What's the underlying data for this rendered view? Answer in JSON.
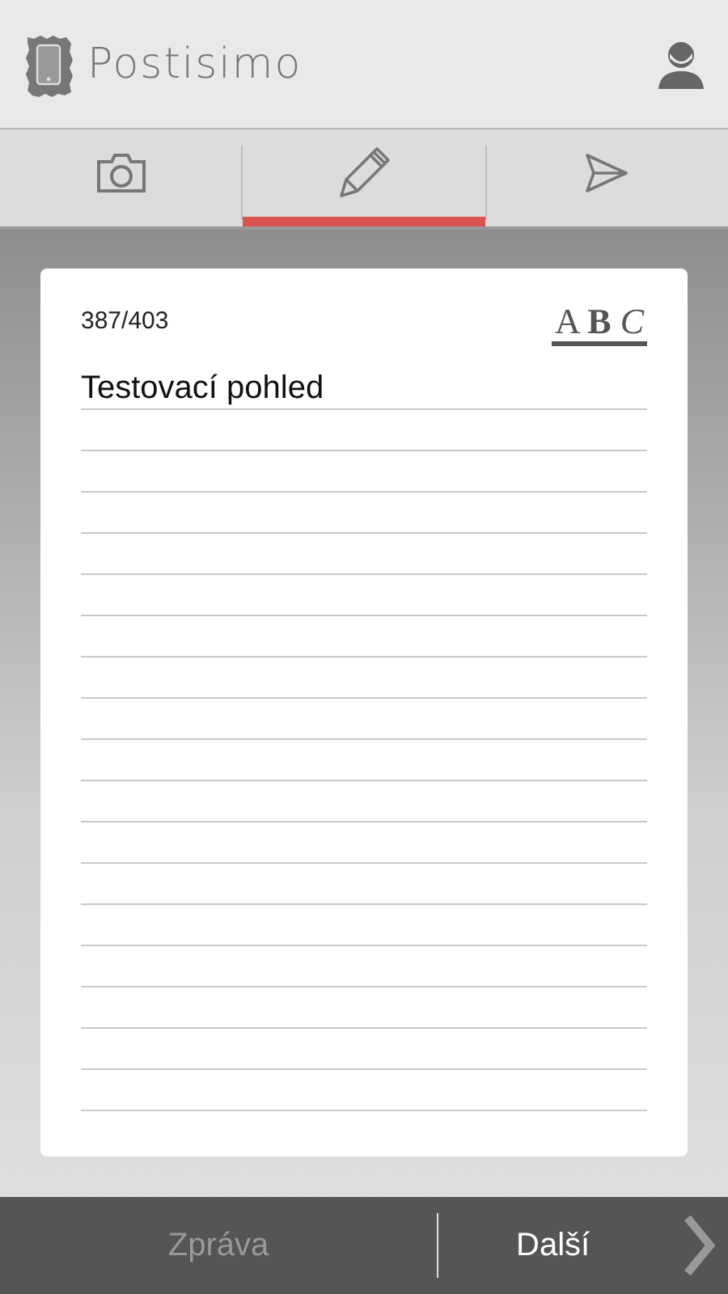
{
  "header": {
    "app_name": "Postisimo"
  },
  "tabs": [
    {
      "kind": "camera",
      "selected": false
    },
    {
      "kind": "pencil",
      "selected": true
    },
    {
      "kind": "send",
      "selected": false
    }
  ],
  "editor": {
    "counter": "387/403",
    "font_style": "A **B** *C*",
    "text": "Testovací pohled"
  },
  "footer": {
    "back": {
      "label": "Zpráva",
      "disabled": true
    },
    "next": {
      "label": "Další",
      "disabled": false
    }
  }
}
